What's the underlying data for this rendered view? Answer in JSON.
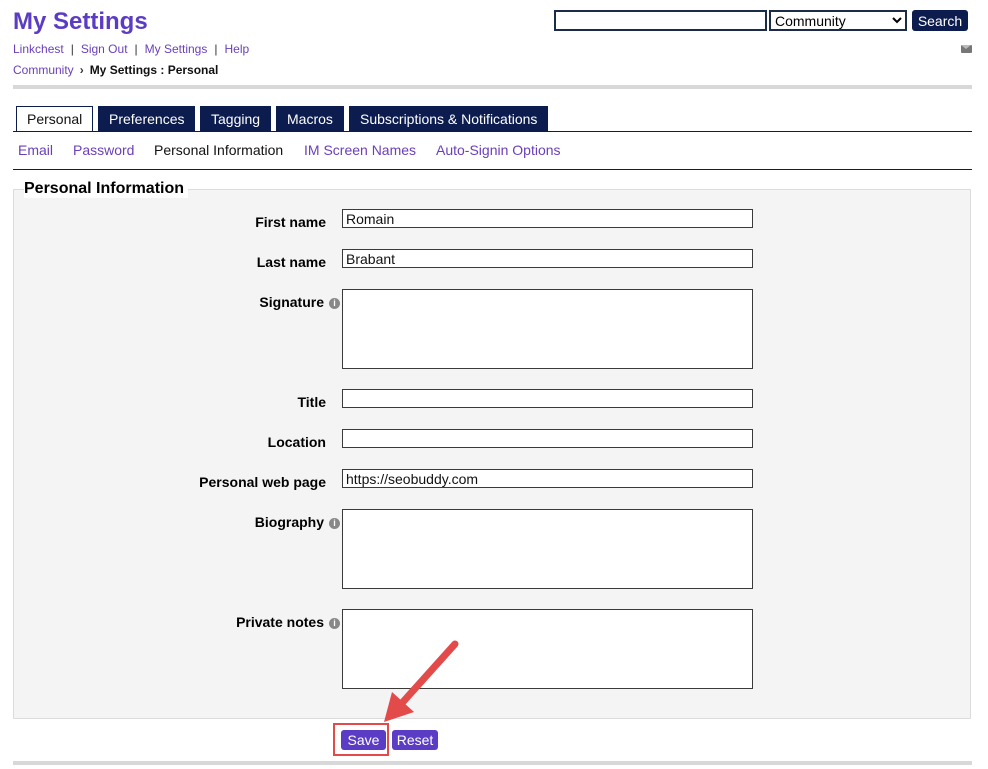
{
  "header": {
    "title": "My Settings",
    "search_value": "",
    "scope_selected": "Community",
    "search_label": "Search"
  },
  "util_links": [
    "Linkchest",
    "Sign Out",
    "My Settings",
    "Help"
  ],
  "breadcrumb": {
    "parent": "Community",
    "current": "My Settings : Personal"
  },
  "tabs": [
    "Personal",
    "Preferences",
    "Tagging",
    "Macros",
    "Subscriptions & Notifications"
  ],
  "subtabs": [
    "Email",
    "Password",
    "Personal Information",
    "IM Screen Names",
    "Auto-Signin Options"
  ],
  "form": {
    "section_title": "Personal Information",
    "first_name_label": "First name",
    "first_name_value": "Romain",
    "last_name_label": "Last name",
    "last_name_value": "Brabant",
    "signature_label": "Signature",
    "title_label": "Title",
    "title_value": "",
    "location_label": "Location",
    "location_value": "",
    "webpage_label": "Personal web page",
    "webpage_value": "https://seobuddy.com",
    "biography_label": "Biography",
    "private_notes_label": "Private notes",
    "info_glyph": "i"
  },
  "actions": {
    "save_label": "Save",
    "reset_label": "Reset"
  },
  "colors": {
    "brand_purple": "#5b3cc4",
    "nav_navy": "#0c1c4e",
    "highlight_red": "#e34a4a"
  }
}
